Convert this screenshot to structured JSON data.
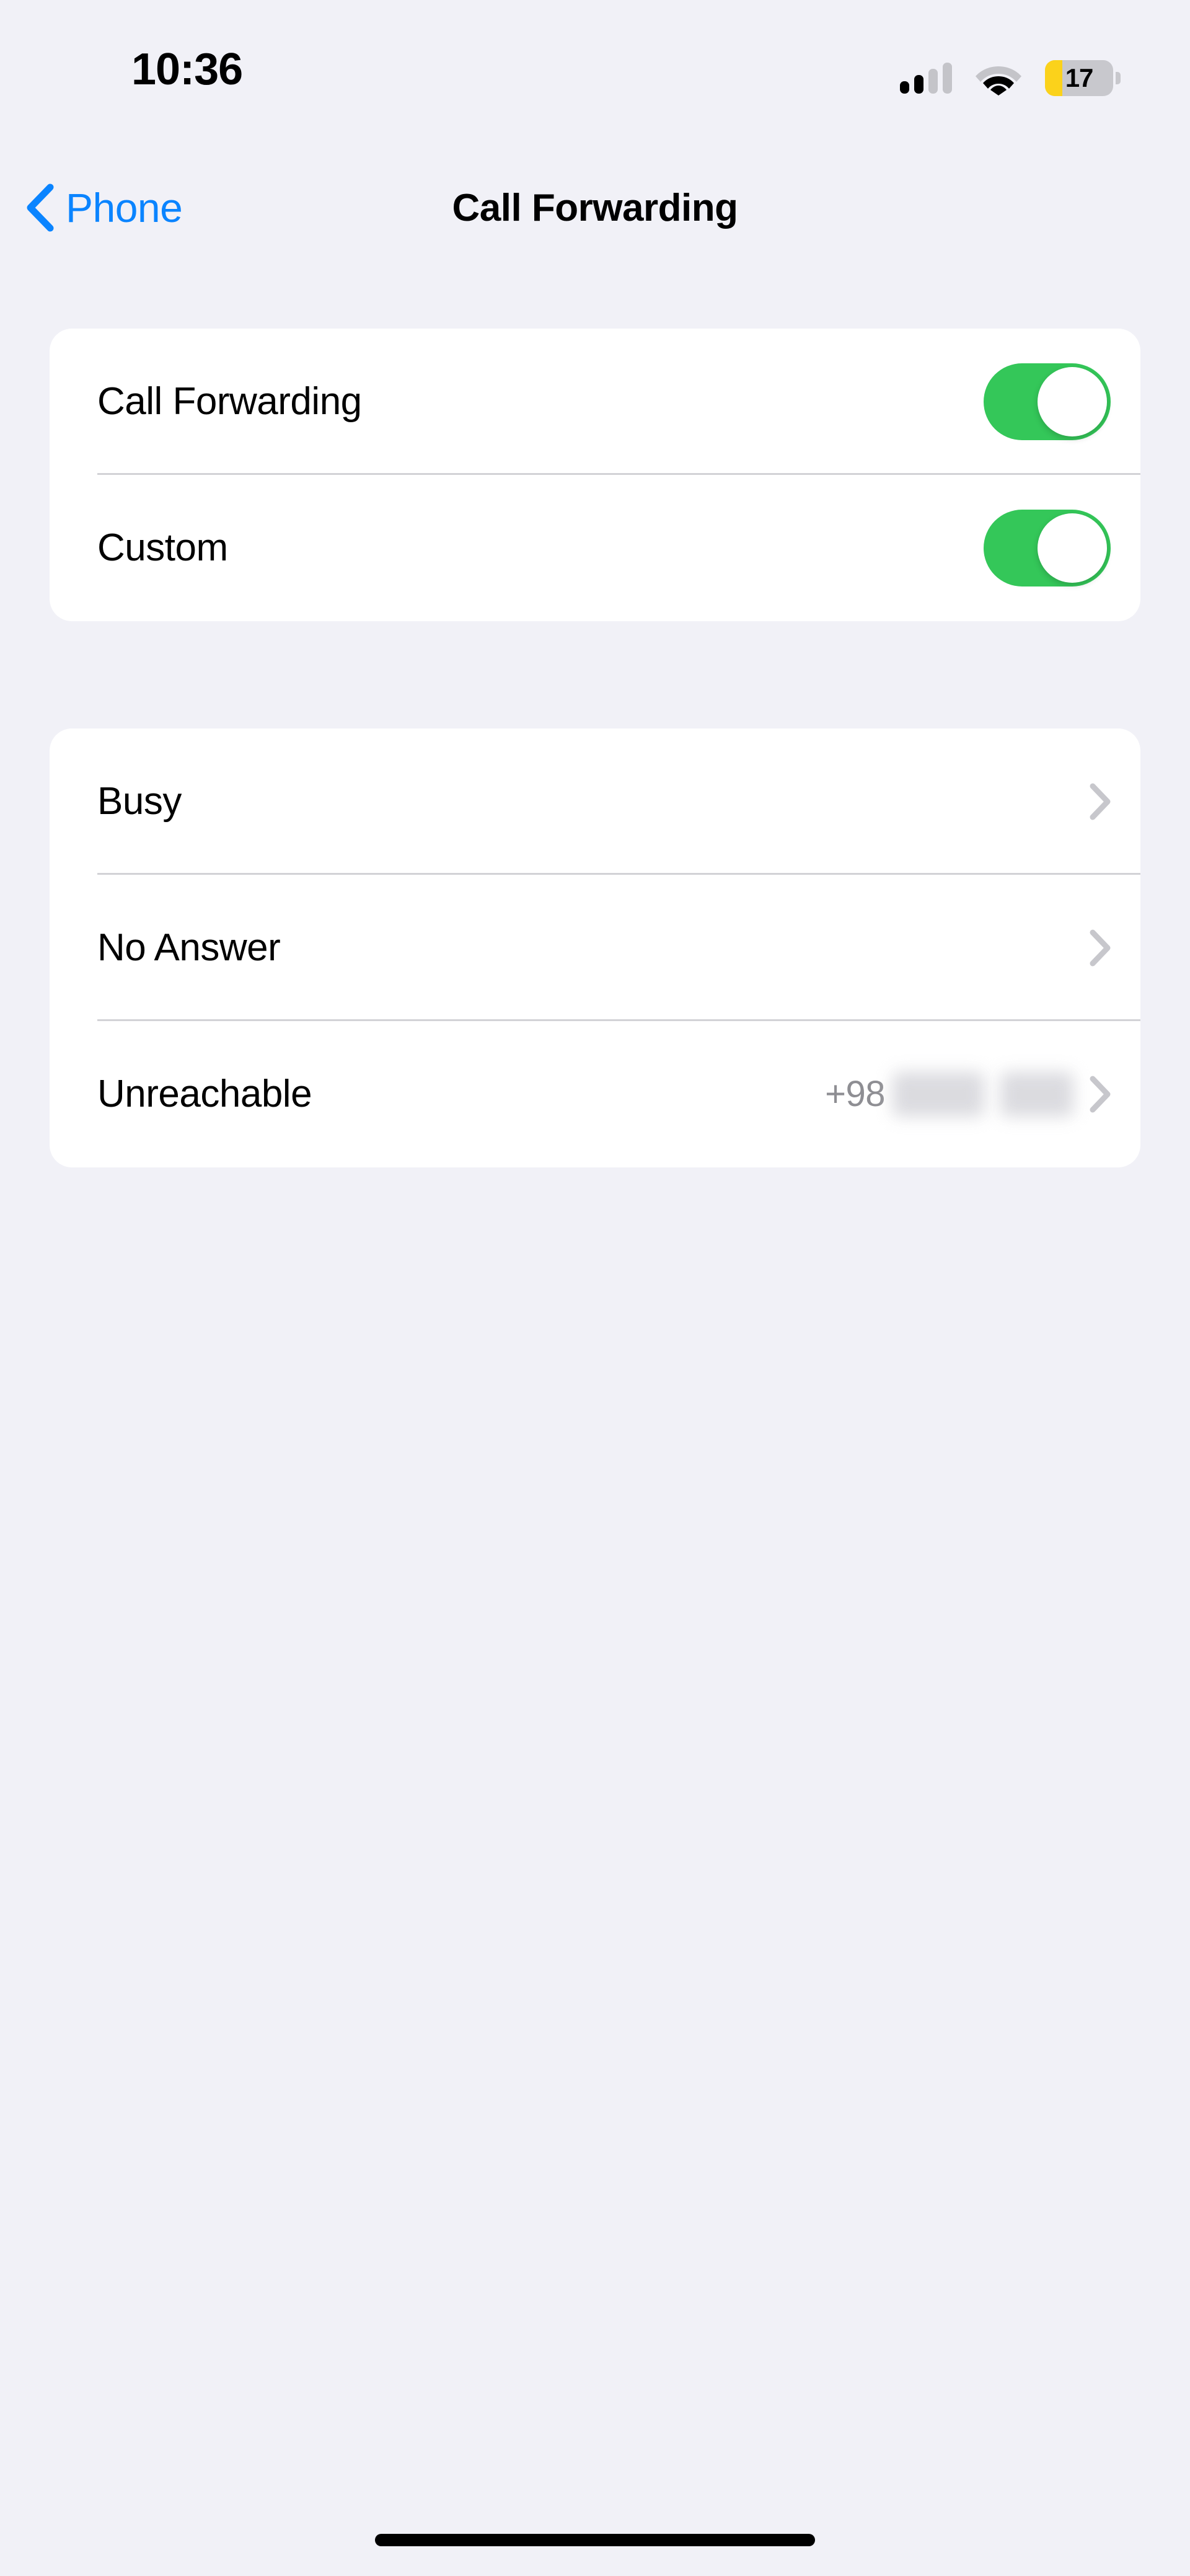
{
  "status_bar": {
    "time": "10:36",
    "signal_icon": "cellular-signal-icon",
    "signal_bars_filled": 2,
    "signal_bars_total": 4,
    "wifi_icon": "wifi-icon",
    "battery_icon": "battery-icon",
    "battery_percent": "17",
    "battery_low_color": "#FBD21B"
  },
  "nav_bar": {
    "back_icon": "chevron-left-icon",
    "back_label": "Phone",
    "title": "Call Forwarding",
    "accent_color": "#0A84FF"
  },
  "toggles_section": {
    "rows": [
      {
        "label": "Call Forwarding",
        "state": "on"
      },
      {
        "label": "Custom",
        "state": "on"
      }
    ],
    "on_color": "#34C759"
  },
  "conditions_section": {
    "rows": [
      {
        "label": "Busy",
        "value": "",
        "chevron_icon": "chevron-right-icon"
      },
      {
        "label": "No Answer",
        "value": "",
        "chevron_icon": "chevron-right-icon"
      },
      {
        "label": "Unreachable",
        "value": "+98",
        "value_redacted": true,
        "chevron_icon": "chevron-right-icon"
      }
    ],
    "value_color": "#8E8E93",
    "chevron_color": "#C7C7CC"
  },
  "home_indicator": {
    "name": "home-indicator"
  },
  "colors": {
    "background": "#F1F1F7",
    "card": "#FFFFFF",
    "separator": "#D2D2D6",
    "text_primary": "#000000"
  }
}
